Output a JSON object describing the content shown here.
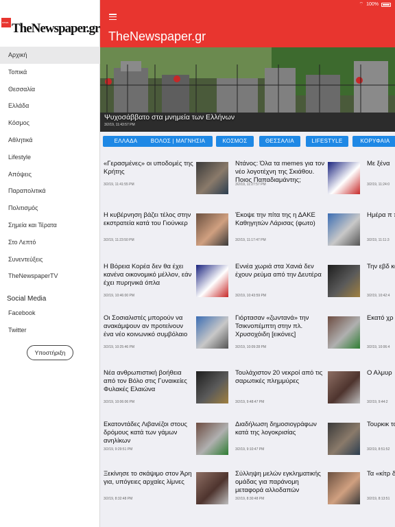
{
  "status_bar": {
    "battery": "100%"
  },
  "sidebar": {
    "logo_mark": "news",
    "logo_text": "TheNewspaper.gr",
    "items": [
      {
        "label": "Αρχική",
        "active": true
      },
      {
        "label": "Τοπικά"
      },
      {
        "label": "Θεσσαλία"
      },
      {
        "label": "Ελλάδα"
      },
      {
        "label": "Κόσμος"
      },
      {
        "label": "Αθλητικά"
      },
      {
        "label": "Lifestyle"
      },
      {
        "label": "Απόψεις"
      },
      {
        "label": "Παραπολιτικά"
      },
      {
        "label": "Πολιτισμός"
      },
      {
        "label": "Σημεία και Τέρατα"
      },
      {
        "label": "Στο Λεπτό"
      },
      {
        "label": "Συνεντεύξεις"
      },
      {
        "label": "TheNewspaperTV"
      }
    ],
    "social_title": "Social Media",
    "social_items": [
      {
        "label": "Facebook"
      },
      {
        "label": "Twitter"
      }
    ],
    "support_label": "Υποστήριξη"
  },
  "header": {
    "title": "TheNewspaper.gr",
    "menu_icon": "hamburger-icon",
    "color": "#e8352f"
  },
  "hero": {
    "title": "Ψυχοσάββατο στα μνημεία των Ελλήνων",
    "time": "3/2/19, 11:43:57 PM"
  },
  "categories": [
    {
      "label": "ΕΛΛΑΔΑ"
    },
    {
      "label": "ΒΟΛΟΣ | ΜΑΓΝΗΣΙΑ"
    },
    {
      "label": "ΚΟΣΜΟΣ"
    },
    {
      "label": "ΘΕΣΣΑΛΙΑ"
    },
    {
      "label": "LIFESTYLE"
    },
    {
      "label": "ΚΟΡΥΦΑΙΑ"
    }
  ],
  "articles": [
    [
      {
        "headline": "«Γερασμένες» οι υποδομές της Κρήτης",
        "time": "3/2/19, 11:41:55 PM"
      },
      {
        "headline": "Η κυβέρνηση βάζει τέλος στην εκστρατεία κατά του Γιούνκερ",
        "time": "3/2/19, 11:23:50 PM"
      },
      {
        "headline": " Η Βόρεια Κορέα δεν θα έχει κανένα οικονομικό μέλλον, εάν έχει πυρηνικά όπλα",
        "time": "3/2/19, 10:46:00 PM"
      },
      {
        "headline": "Οι Σοσιαλιστές μπορούν να ανακάμψουν αν προτείνουν ένα νέο κοινωνικό συμβόλαιο",
        "time": "3/2/19, 10:25:46 PM"
      },
      {
        "headline": "Νέα ανθρωπιστική βοήθεια από τον Βόλο στις Γυναικείες Φυλακές Ελαιώνα",
        "time": "3/2/19, 10:06:06 PM"
      },
      {
        "headline": "Εκατοντάδες Λιβανέζοι στους δρόμους κατά των γάμων ανηλίκων",
        "time": "3/2/19, 9:29:51 PM"
      },
      {
        "headline": "Ξεκίνησε το σκάψιμο στον Άρη για, υπόγειες αρχαίες λίμνες",
        "time": "3/2/19, 8:32:48 PM"
      }
    ],
    [
      {
        "headline": "Ντάνος: Όλα τα memes για τον νέο λογοτέχνη της Σκιάθου. Ποιος Παπαδιαμάντης;",
        "time": "3/2/19, 11:27:57 PM"
      },
      {
        "headline": "Έκοψε την πίτα της η ΔΑΚΕ Καθηγητών Λάρισας (φωτο)",
        "time": "3/2/19, 11:17:47 PM"
      },
      {
        "headline": "Εννέα χωριά στα Χανιά δεν έχουν ρεύμα από την Δευτέρα",
        "time": "3/2/19, 10:43:59 PM"
      },
      {
        "headline": "Γιόρτασαν «ζωντανά» την Τσικνοπέμπτη στην πλ. Χρυσοχόιδη [εικόνες]",
        "time": "3/2/19, 10:09:28 PM"
      },
      {
        "headline": "Τουλάχιστον 20 νεκροί από τις σαρωτικές πλημμύρες",
        "time": "3/2/19, 9:48:47 PM"
      },
      {
        "headline": "Διαδήλωση δημοσιογράφων κατά της λογοκρισίας",
        "time": "3/2/19, 9:10:47 PM"
      },
      {
        "headline": "Σύλληψη μελών εγκληματικής ομάδας για παράνομη μεταφορά αλλοδαπών",
        "time": "3/2/19, 8:30:48 PM"
      }
    ],
    [
      {
        "headline": "Με ξένα",
        "time": "3/2/19, 11:24:0"
      },
      {
        "headline": "Ημέρα π πεζών τ στον Βό",
        "time": "3/2/19, 11:11:3"
      },
      {
        "headline": "Την εβδ κατατίθε «νόμος Ι",
        "time": "3/2/19, 10:42:4"
      },
      {
        "headline": "Εκατό χρ ίδρυση τ Κομμου",
        "time": "3/2/19, 10:06:4"
      },
      {
        "headline": "Ο Αλμυρ",
        "time": "3/2/19, 9:44:2"
      },
      {
        "headline": "Τουρκικ των Κού",
        "time": "3/2/19, 8:51:52"
      },
      {
        "headline": "Τα «κίτρ δρόμους",
        "time": "3/2/19, 8:13:51"
      }
    ]
  ]
}
